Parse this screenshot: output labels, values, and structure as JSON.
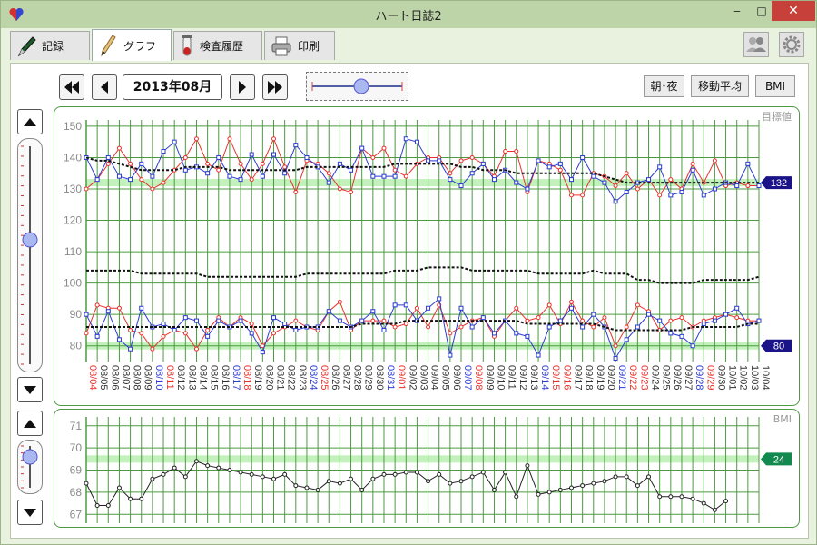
{
  "window": {
    "title": "ハート日誌2"
  },
  "tabs": [
    {
      "label": "記録",
      "icon": "pen-icon"
    },
    {
      "label": "グラフ",
      "icon": "pencil-icon"
    },
    {
      "label": "検査履歴",
      "icon": "test-tube-icon"
    },
    {
      "label": "印刷",
      "icon": "printer-icon"
    }
  ],
  "toolbar": {
    "month": "2013年08月",
    "buttons": {
      "morning_night": "朝･夜",
      "moving_average": "移動平均",
      "bmi": "BMI"
    }
  },
  "colors": {
    "grid": "#4d9a42",
    "target_band": "#9be88e",
    "morning": "#e8312c",
    "night": "#2b3bd0",
    "average": "#111111",
    "target_badge": "#1b1488",
    "bmi_badge": "#12894e",
    "weekend": "#e8312c"
  },
  "chart_data": [
    {
      "type": "line",
      "corner_label": "目標値",
      "ylim": [
        75,
        152
      ],
      "yticks": [
        80,
        90,
        100,
        110,
        120,
        130,
        140,
        150
      ],
      "targets": [
        132,
        80
      ],
      "x": [
        "08/04",
        "08/05",
        "08/06",
        "08/07",
        "08/08",
        "08/09",
        "08/10",
        "08/11",
        "08/12",
        "08/13",
        "08/14",
        "08/15",
        "08/16",
        "08/17",
        "08/18",
        "08/19",
        "08/20",
        "08/21",
        "08/22",
        "08/23",
        "08/24",
        "08/25",
        "08/26",
        "08/27",
        "08/28",
        "08/29",
        "08/30",
        "08/31",
        "09/01",
        "09/02",
        "09/03",
        "09/04",
        "09/05",
        "09/06",
        "09/07",
        "09/08",
        "09/09",
        "09/10",
        "09/11",
        "09/12",
        "09/13",
        "09/14",
        "09/15",
        "09/16",
        "09/17",
        "09/18",
        "09/19",
        "09/20",
        "09/21",
        "09/22",
        "09/23",
        "09/24",
        "09/25",
        "09/26",
        "09/27",
        "09/28",
        "09/29",
        "09/30",
        "10/01",
        "10/02",
        "10/03",
        "10/04"
      ],
      "x_red": [
        "08/04",
        "08/11",
        "08/18",
        "08/25",
        "09/01",
        "09/08",
        "09/15",
        "09/16",
        "09/22",
        "09/23",
        "09/29"
      ],
      "x_blue": [
        "08/10",
        "08/17",
        "08/24",
        "08/31",
        "09/07",
        "09/14",
        "09/21",
        "09/28"
      ],
      "series": [
        {
          "name": "",
          "role": "systolic-morning",
          "values": [
            130,
            133,
            138,
            143,
            138,
            133,
            130,
            132,
            136,
            140,
            146,
            138,
            136,
            146,
            138,
            133,
            138,
            146,
            137,
            129,
            139,
            138,
            135,
            130,
            129,
            143,
            140,
            143,
            136,
            134,
            138,
            140,
            140,
            135,
            139,
            140,
            138,
            134,
            142,
            142,
            129,
            139,
            138,
            136,
            128,
            128,
            135,
            134,
            131,
            135,
            130,
            133,
            128,
            133,
            130,
            138,
            132,
            139,
            131,
            132,
            131,
            131
          ]
        },
        {
          "name": "",
          "role": "systolic-night",
          "values": [
            140,
            133,
            140,
            134,
            133,
            138,
            134,
            142,
            145,
            136,
            137,
            135,
            140,
            134,
            133,
            141,
            134,
            141,
            135,
            144,
            140,
            137,
            132,
            138,
            136,
            143,
            134,
            134,
            134,
            146,
            145,
            139,
            139,
            133,
            131,
            135,
            138,
            133,
            136,
            132,
            130,
            139,
            137,
            138,
            133,
            140,
            134,
            132,
            126,
            129,
            132,
            133,
            137,
            128,
            129,
            136,
            128,
            130,
            132,
            131,
            138,
            131
          ]
        },
        {
          "name": "",
          "role": "systolic-average",
          "values": [
            140,
            139,
            139,
            138,
            137,
            136,
            136,
            136,
            136,
            137,
            137,
            137,
            137,
            136,
            136,
            136,
            136,
            136,
            136,
            136,
            137,
            137,
            137,
            137,
            137,
            137,
            137,
            137,
            138,
            138,
            138,
            138,
            138,
            138,
            137,
            137,
            136,
            136,
            136,
            135,
            135,
            135,
            135,
            135,
            135,
            135,
            135,
            134,
            133,
            132,
            132,
            132,
            132,
            132,
            132,
            132,
            132,
            132,
            132,
            132,
            132,
            132
          ]
        },
        {
          "name": "",
          "role": "diastolic-morning",
          "values": [
            84,
            93,
            92,
            92,
            85,
            84,
            79,
            83,
            85,
            84,
            79,
            85,
            89,
            86,
            89,
            87,
            80,
            84,
            86,
            88,
            86,
            85,
            91,
            94,
            85,
            88,
            88,
            88,
            86,
            87,
            92,
            86,
            93,
            84,
            86,
            88,
            89,
            83,
            88,
            92,
            88,
            89,
            93,
            87,
            94,
            88,
            86,
            89,
            80,
            86,
            93,
            91,
            85,
            88,
            89,
            86,
            88,
            89,
            90,
            89,
            88,
            88
          ]
        },
        {
          "name": "",
          "role": "diastolic-night",
          "values": [
            90,
            83,
            91,
            82,
            79,
            92,
            86,
            87,
            85,
            89,
            88,
            83,
            88,
            86,
            88,
            84,
            78,
            89,
            87,
            85,
            86,
            86,
            91,
            88,
            86,
            88,
            91,
            85,
            93,
            93,
            88,
            92,
            95,
            77,
            92,
            86,
            89,
            84,
            88,
            84,
            83,
            77,
            86,
            88,
            92,
            86,
            90,
            86,
            76,
            82,
            86,
            90,
            88,
            84,
            83,
            80,
            87,
            88,
            90,
            92,
            87,
            88
          ]
        },
        {
          "name": "",
          "role": "diastolic-average",
          "values": [
            86,
            86,
            86,
            86,
            86,
            86,
            86,
            86,
            86,
            86,
            86,
            86,
            86,
            86,
            86,
            86,
            86,
            86,
            86,
            86,
            86,
            86,
            86,
            86,
            86,
            87,
            87,
            87,
            87,
            88,
            88,
            88,
            88,
            88,
            88,
            88,
            88,
            88,
            88,
            88,
            87,
            87,
            87,
            87,
            87,
            87,
            87,
            86,
            85,
            85,
            85,
            85,
            85,
            85,
            85,
            86,
            86,
            86,
            86,
            86,
            87,
            87
          ]
        },
        {
          "name": "",
          "role": "pulse-average",
          "values": [
            104,
            104,
            104,
            104,
            104,
            103,
            103,
            103,
            103,
            103,
            103,
            102,
            102,
            102,
            102,
            102,
            102,
            102,
            102,
            102,
            103,
            103,
            103,
            103,
            103,
            103,
            103,
            103,
            104,
            104,
            104,
            105,
            105,
            105,
            105,
            104,
            104,
            104,
            104,
            104,
            104,
            103,
            103,
            103,
            103,
            103,
            104,
            103,
            103,
            103,
            101,
            101,
            100,
            100,
            100,
            100,
            101,
            101,
            101,
            101,
            101,
            102
          ]
        }
      ]
    },
    {
      "type": "line",
      "corner_label": "BMI",
      "ylim": [
        66.6,
        71.4
      ],
      "yticks": [
        67,
        68,
        69,
        70,
        71
      ],
      "targets": [
        24
      ],
      "target_band_y": 69.5,
      "series": [
        {
          "name": "",
          "role": "bmi",
          "values": [
            68.4,
            67.4,
            67.4,
            68.2,
            67.7,
            67.7,
            68.6,
            68.8,
            69.1,
            68.7,
            69.4,
            69.2,
            69.1,
            69.0,
            68.9,
            68.8,
            68.7,
            68.6,
            68.8,
            68.3,
            68.2,
            68.1,
            68.5,
            68.4,
            68.6,
            68.1,
            68.6,
            68.8,
            68.8,
            68.9,
            68.9,
            68.5,
            68.8,
            68.4,
            68.5,
            68.7,
            68.9,
            68.1,
            68.9,
            67.8,
            69.2,
            67.9,
            68.0,
            68.1,
            68.2,
            68.3,
            68.4,
            68.5,
            68.7,
            68.7,
            68.3,
            68.7,
            67.8,
            67.8,
            67.8,
            67.7,
            67.5,
            67.2,
            67.6,
            null,
            null,
            null
          ]
        }
      ]
    }
  ]
}
